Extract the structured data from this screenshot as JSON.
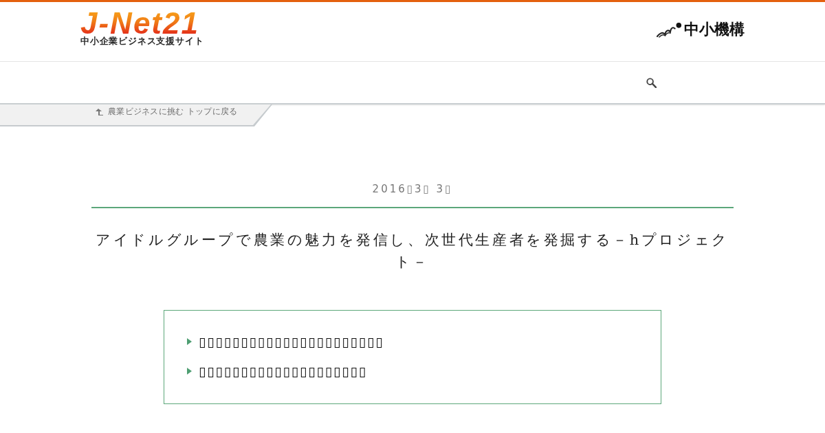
{
  "header": {
    "logo": {
      "name": "J-Net21",
      "tagline": "中小企業ビジネス支援サイト"
    },
    "partner_logo": {
      "name": "中小機構"
    }
  },
  "breadcrumb": {
    "link": "農業ビジネスに挑む トップに戻る"
  },
  "article": {
    "date": "2016▯3▯ 3▯",
    "title": "アイドルグループで農業の魅力を発信し、次世代生産者を発掘する－hプロジェクト－",
    "summary": [
      "▯▯▯▯▯▯▯▯▯▯▯▯▯▯▯▯▯▯▯▯▯▯",
      "▯▯▯▯▯▯▯▯▯▯▯▯▯▯▯▯▯▯▯▯"
    ]
  }
}
